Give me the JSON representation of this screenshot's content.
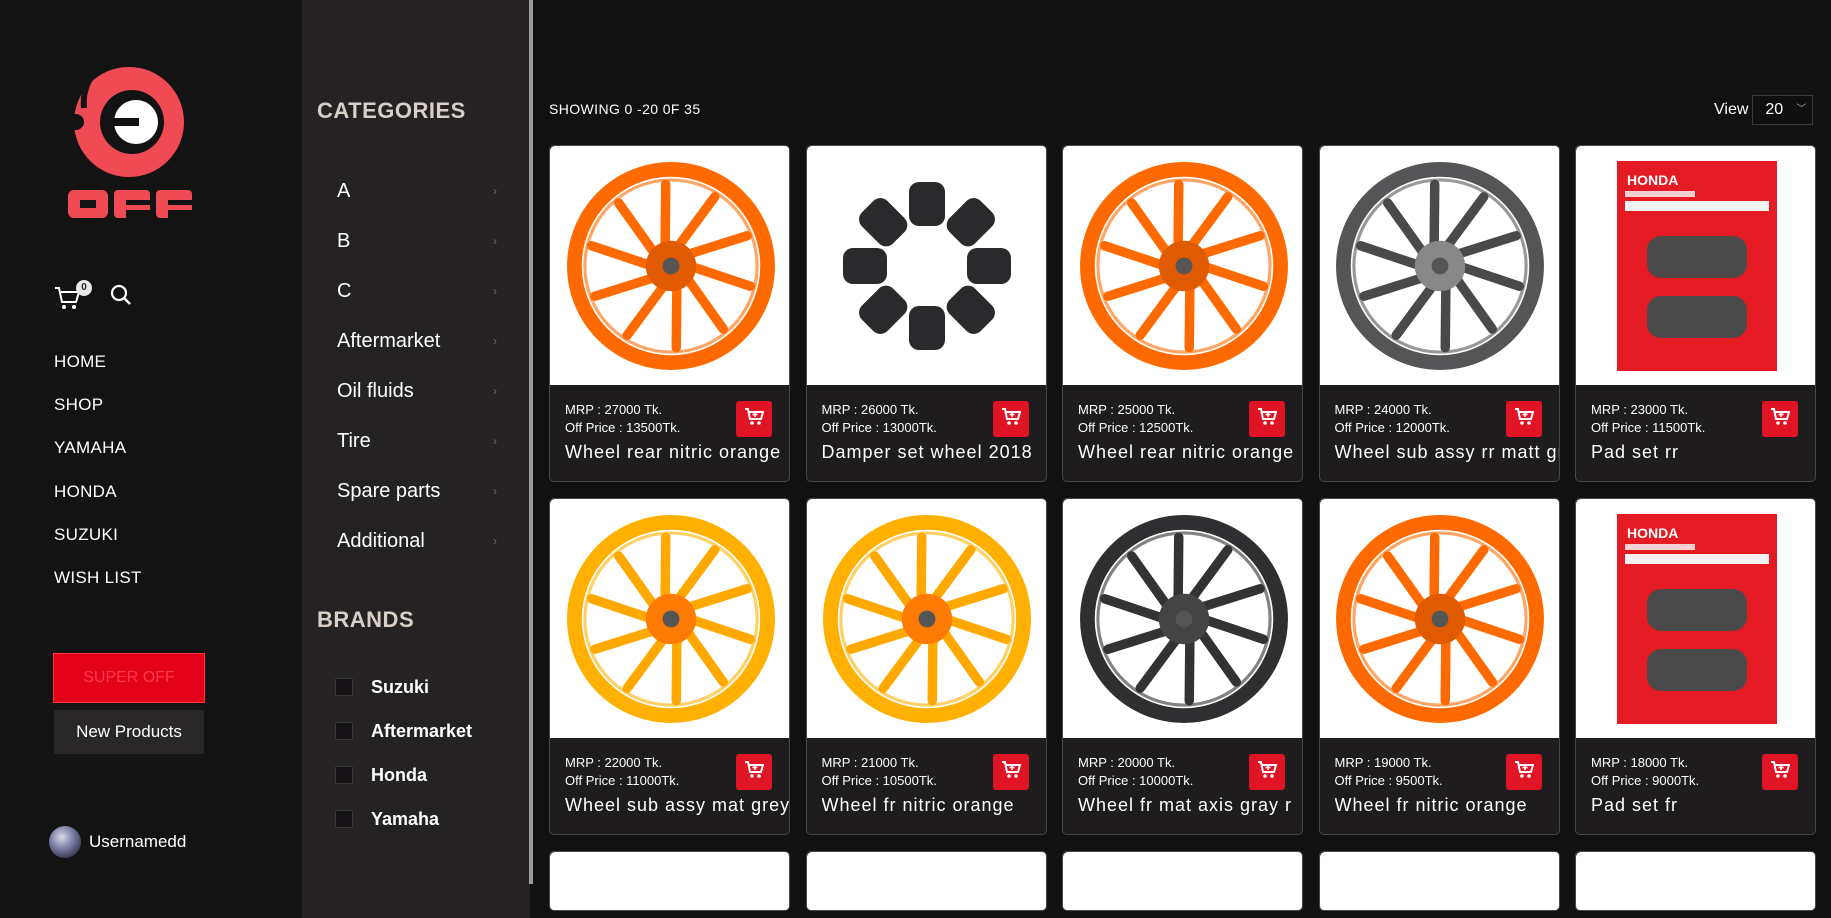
{
  "brand": {
    "logo_text": "OFF"
  },
  "header": {
    "cart_count": "0"
  },
  "menu": [
    "HOME",
    "SHOP",
    "YAMAHA",
    "HONDA",
    "SUZUKI",
    "WISH LIST"
  ],
  "buttons": {
    "super_off": "SUPER OFF",
    "new_products": "New Products"
  },
  "user": {
    "name": "Usernamedd"
  },
  "sidebar": {
    "categories_title": "CATEGORIES",
    "categories": [
      "A",
      "B",
      "C",
      "Aftermarket",
      "Oil fluids",
      "Tire",
      "Spare parts",
      "Additional"
    ],
    "brands_title": "BRANDS",
    "brands": [
      "Suzuki",
      "Aftermarket",
      "Honda",
      "Yamaha"
    ]
  },
  "main": {
    "showing": "SHOWING 0 -20 0F 35",
    "view_label": "View",
    "view_value": "20"
  },
  "colors": {
    "accent": "#e01424",
    "logo": "#f04a55"
  },
  "products": [
    {
      "mrp": "MRP : 27000 Tk.",
      "off": "Off Price : 13500Tk.",
      "name": "Wheel rear nitric orange",
      "image": "orange-wheel"
    },
    {
      "mrp": "MRP : 26000 Tk.",
      "off": "Off Price : 13000Tk.",
      "name": "Damper set wheel 2018",
      "image": "damper-set"
    },
    {
      "mrp": "MRP : 25000 Tk.",
      "off": "Off Price : 12500Tk.",
      "name": "Wheel rear nitric orange",
      "image": "orange-wheel"
    },
    {
      "mrp": "MRP : 24000 Tk.",
      "off": "Off Price : 12000Tk.",
      "name": "Wheel sub assy rr matt gray",
      "image": "gray-wheel"
    },
    {
      "mrp": "MRP : 23000 Tk.",
      "off": "Off Price : 11500Tk.",
      "name": "Pad set rr",
      "image": "brake-pad"
    },
    {
      "mrp": "MRP : 22000 Tk.",
      "off": "Off Price : 11000Tk.",
      "name": "Wheel sub assy mat grey",
      "image": "yellow-wheel"
    },
    {
      "mrp": "MRP : 21000 Tk.",
      "off": "Off Price : 10500Tk.",
      "name": "Wheel fr nitric orange",
      "image": "yellow-wheel"
    },
    {
      "mrp": "MRP : 20000 Tk.",
      "off": "Off Price : 10000Tk.",
      "name": "Wheel fr mat axis gray r",
      "image": "black-wheel"
    },
    {
      "mrp": "MRP : 19000 Tk.",
      "off": "Off Price : 9500Tk.",
      "name": "Wheel fr nitric orange",
      "image": "orange-wheel"
    },
    {
      "mrp": "MRP : 18000 Tk.",
      "off": "Off Price : 9000Tk.",
      "name": "Pad set fr",
      "image": "brake-pad"
    }
  ]
}
